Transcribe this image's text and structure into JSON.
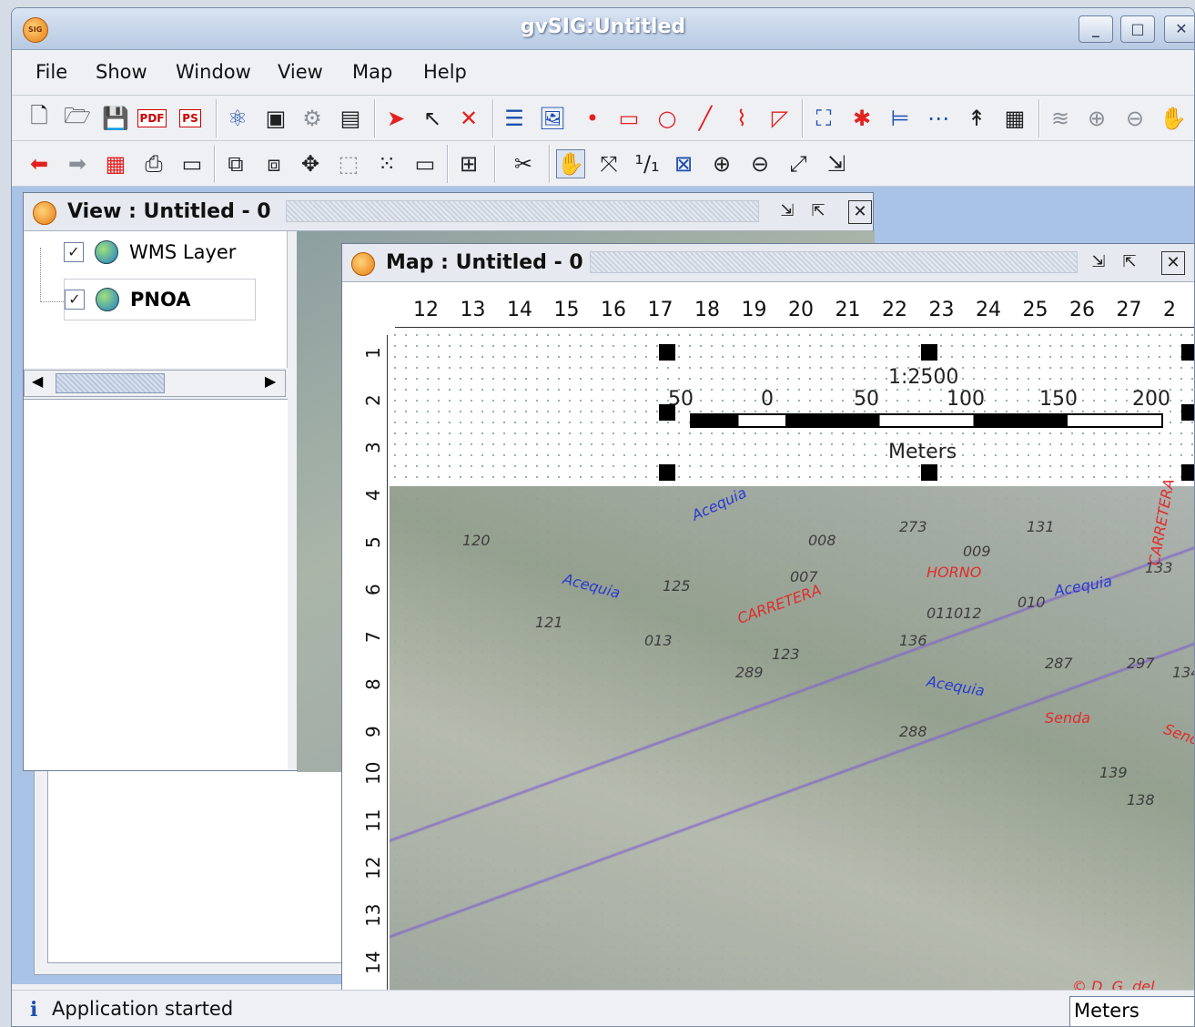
{
  "window": {
    "title": "gvSIG:Untitled",
    "controls": [
      "_",
      "□",
      "✕"
    ]
  },
  "menu": [
    "File",
    "Show",
    "Window",
    "View",
    "Map",
    "Help"
  ],
  "view_frame": {
    "title": "View : Untitled  -  0",
    "layers": [
      {
        "name": "WMS Layer",
        "checked": true
      },
      {
        "name": "PNOA",
        "checked": true
      }
    ]
  },
  "map_frame": {
    "title": "Map : Untitled  -  0",
    "ruler_h": [
      "12",
      "13",
      "14",
      "15",
      "16",
      "17",
      "18",
      "19",
      "20",
      "21",
      "22",
      "23",
      "24",
      "25",
      "26",
      "27",
      "2"
    ],
    "ruler_v": [
      "1",
      "2",
      "3",
      "4",
      "5",
      "6",
      "7",
      "8",
      "9",
      "10",
      "11",
      "12",
      "13",
      "14"
    ],
    "scale_text": "1:2500",
    "scale_ticks": [
      "50",
      "0",
      "50",
      "100",
      "150",
      "200"
    ],
    "scale_units": "Meters",
    "map_labels": [
      {
        "text": "Acequia",
        "color": "blue"
      },
      {
        "text": "Acequia",
        "color": "blue"
      },
      {
        "text": "Acequia",
        "color": "blue"
      },
      {
        "text": "Acequia",
        "color": "blue"
      },
      {
        "text": "CARRETERA",
        "color": "red"
      },
      {
        "text": "CARRETERA",
        "color": "red"
      },
      {
        "text": "HORNO",
        "color": "red"
      },
      {
        "text": "Senda",
        "color": "red"
      },
      {
        "text": "Senda",
        "color": "red"
      },
      {
        "text": "273",
        "color": "dark"
      },
      {
        "text": "131",
        "color": "dark"
      },
      {
        "text": "133",
        "color": "dark"
      },
      {
        "text": "120",
        "color": "dark"
      },
      {
        "text": "125",
        "color": "dark"
      },
      {
        "text": "121",
        "color": "dark"
      },
      {
        "text": "123",
        "color": "dark"
      },
      {
        "text": "136",
        "color": "dark"
      },
      {
        "text": "287",
        "color": "dark"
      },
      {
        "text": "289",
        "color": "dark"
      },
      {
        "text": "288",
        "color": "dark"
      },
      {
        "text": "297",
        "color": "dark"
      },
      {
        "text": "134",
        "color": "dark"
      },
      {
        "text": "138",
        "color": "dark"
      },
      {
        "text": "139",
        "color": "dark"
      },
      {
        "text": "008",
        "color": "dark"
      },
      {
        "text": "009",
        "color": "dark"
      },
      {
        "text": "007",
        "color": "dark"
      },
      {
        "text": "012",
        "color": "dark"
      },
      {
        "text": "013",
        "color": "dark"
      },
      {
        "text": "011",
        "color": "dark"
      },
      {
        "text": "010",
        "color": "dark"
      },
      {
        "text": "© D. G. del Catastro",
        "color": "red"
      }
    ]
  },
  "status": {
    "message": "Application started",
    "units": "Meters"
  },
  "colors": {
    "accent": "#1e4fae",
    "desktop": "#a9c3e6",
    "red_label": "#e02020",
    "blue_label": "#2030d0"
  }
}
